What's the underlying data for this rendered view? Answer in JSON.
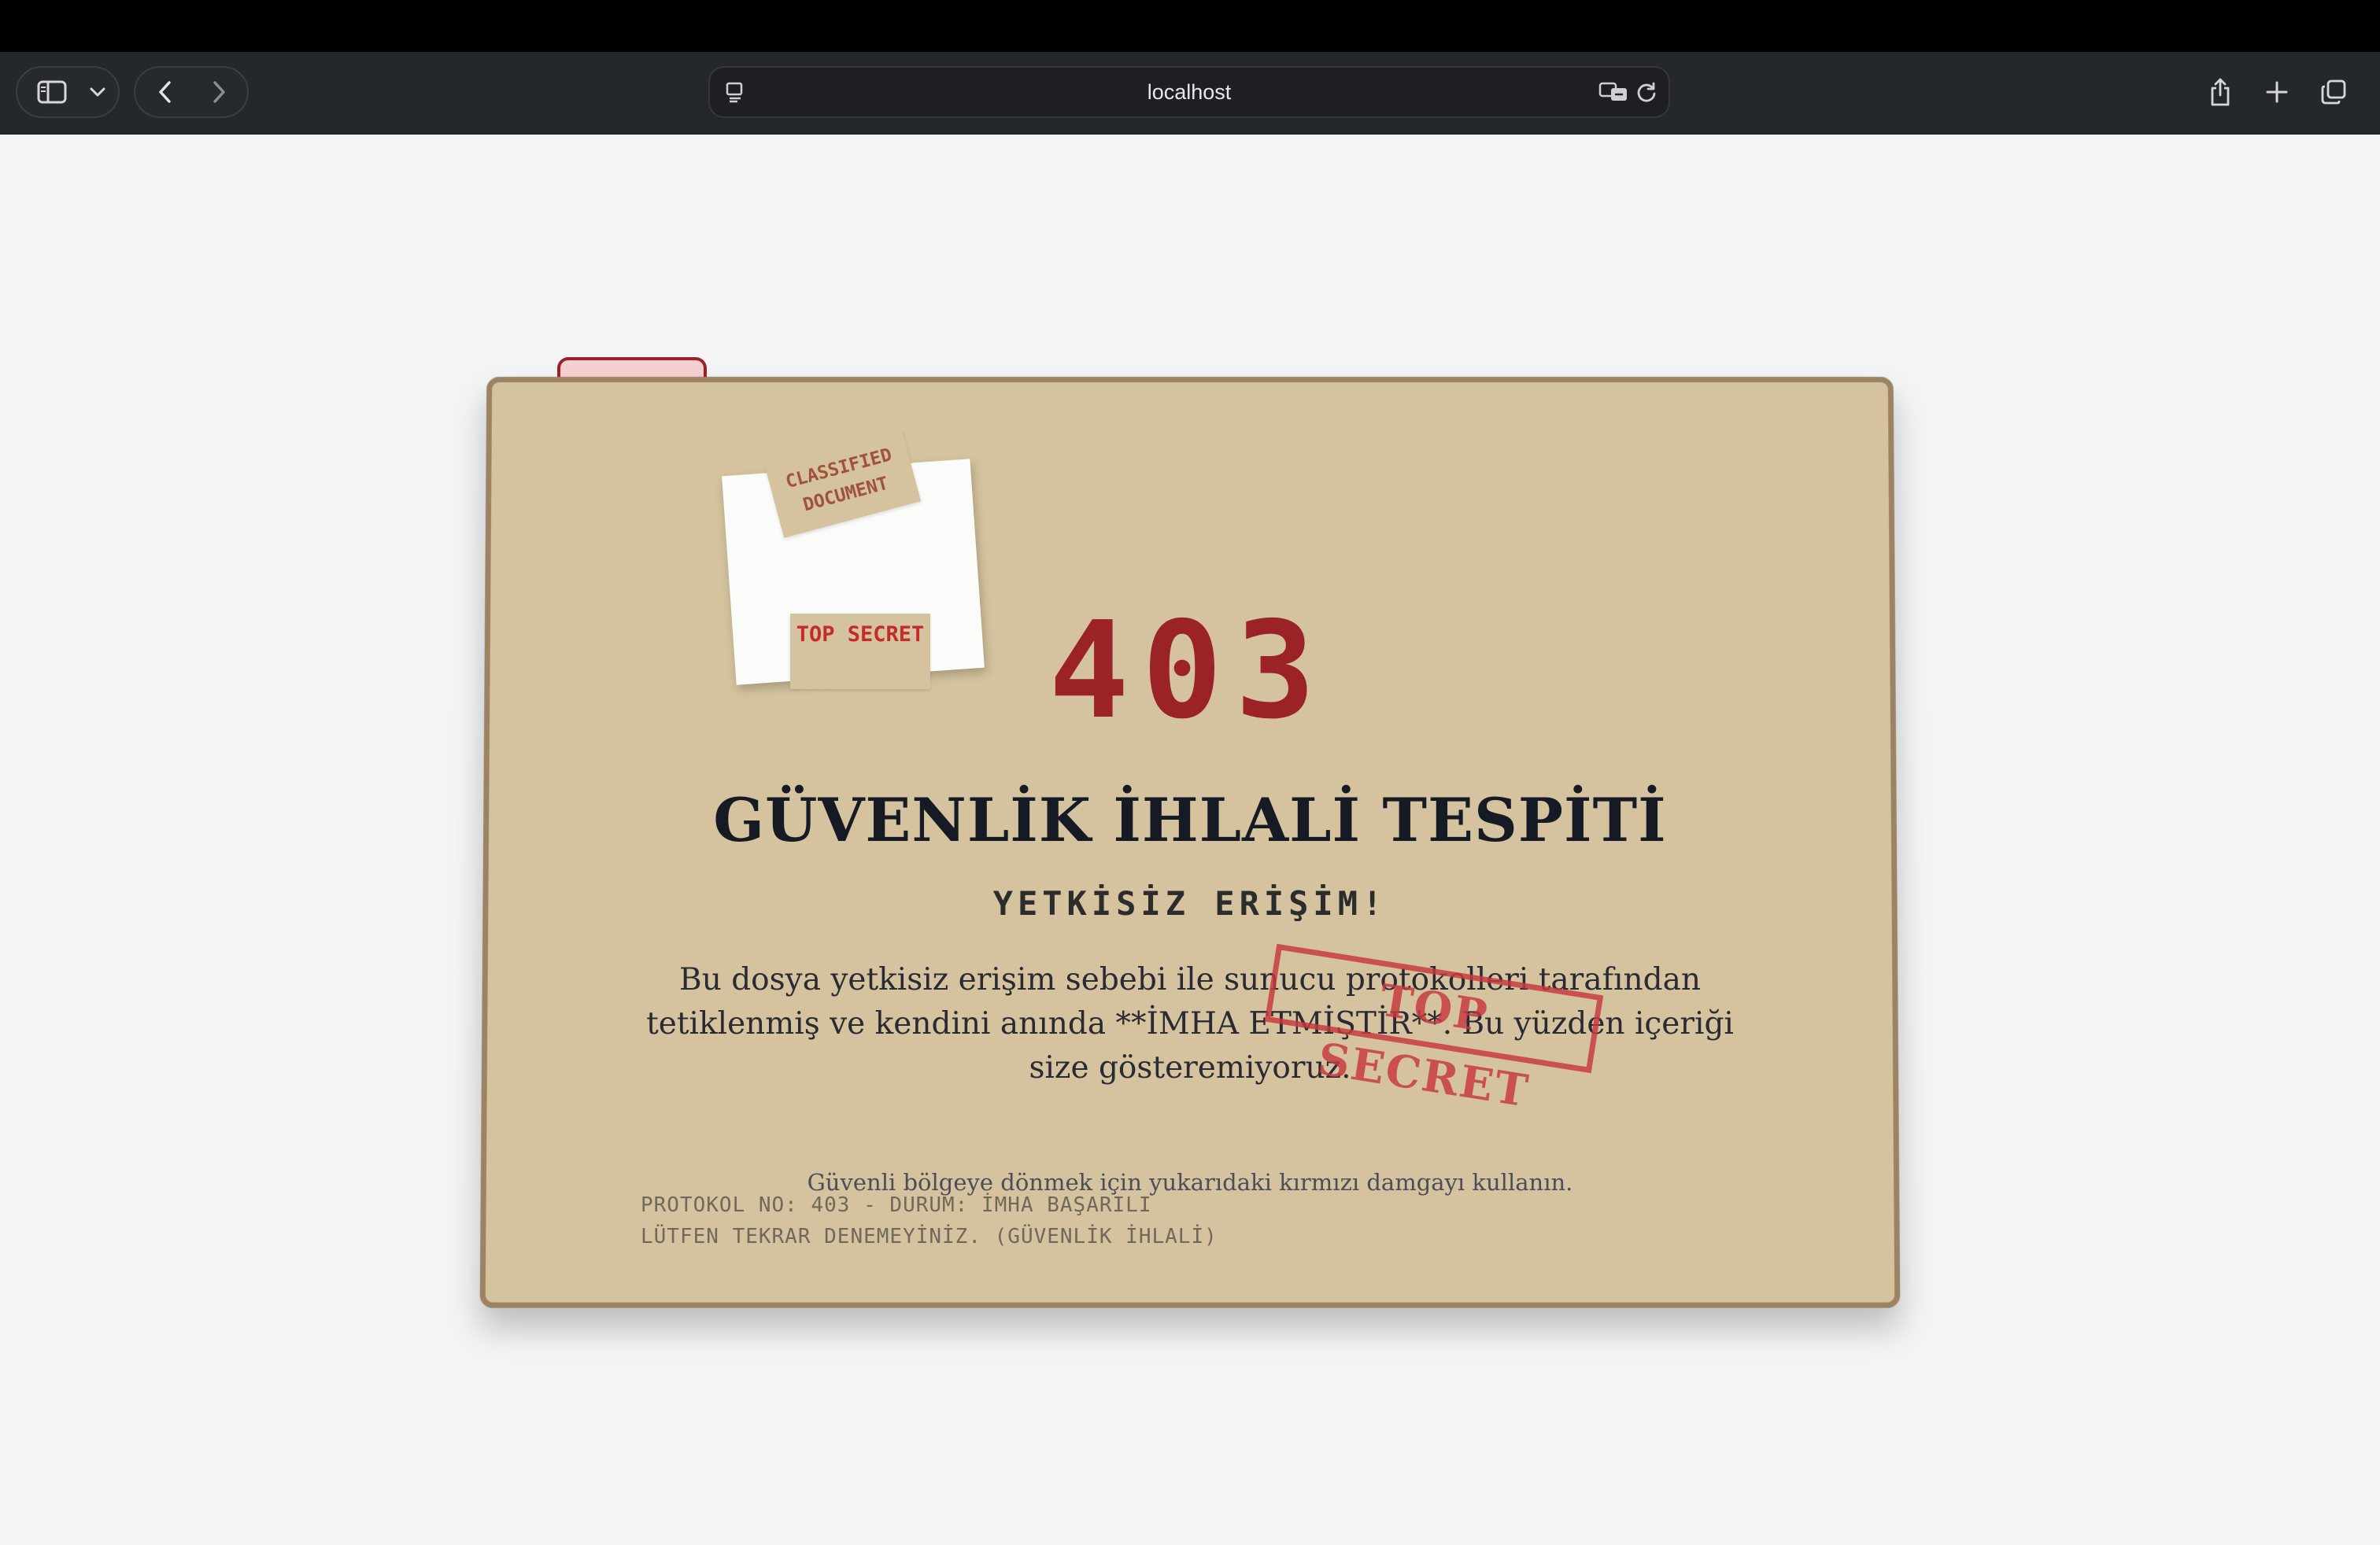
{
  "browser": {
    "url": "localhost",
    "icons": {
      "sidebar": "sidebar-icon",
      "chevron": "chevron-down-icon",
      "back": "back-arrow-icon",
      "forward": "forward-arrow-icon",
      "page": "page-menu-icon",
      "translate": "translate-icon",
      "reload": "reload-icon",
      "share": "share-icon",
      "new_tab": "plus-icon",
      "tabs": "tabs-overview-icon"
    }
  },
  "folder": {
    "tape_classified": "CLASSIFIED DOCUMENT",
    "tape_top_secret": "TOP SECRET",
    "code": "403",
    "title": "GÜVENLİK İHLALİ TESPİTİ",
    "subtitle": "YETKİSİZ ERİŞİM!",
    "description": "Bu dosya yetkisiz erişim sebebi ile sunucu protokolleri tarafından tetiklenmiş ve kendini anında **İMHA ETMİŞTİR**. Bu yüzden içeriği size gösteremiyoruz.",
    "stamp": "TOP SECRET",
    "hint": "Güvenli bölgeye dönmek için yukarıdaki kırmızı damgayı kullanın.",
    "protocol_line1": "PROTOKOL NO: 403 - DURUM: İMHA BAŞARILI",
    "protocol_line2": "LÜTFEN TEKRAR DENEMEYİNİZ. (GÜVENLİK İHLALİ)"
  },
  "colors": {
    "folder": "#d4c39e",
    "folder_border": "#9c8364",
    "accent_red": "#9b2226",
    "stamp_red": "#c9383f",
    "tab_pink": "#f6cfd0"
  }
}
